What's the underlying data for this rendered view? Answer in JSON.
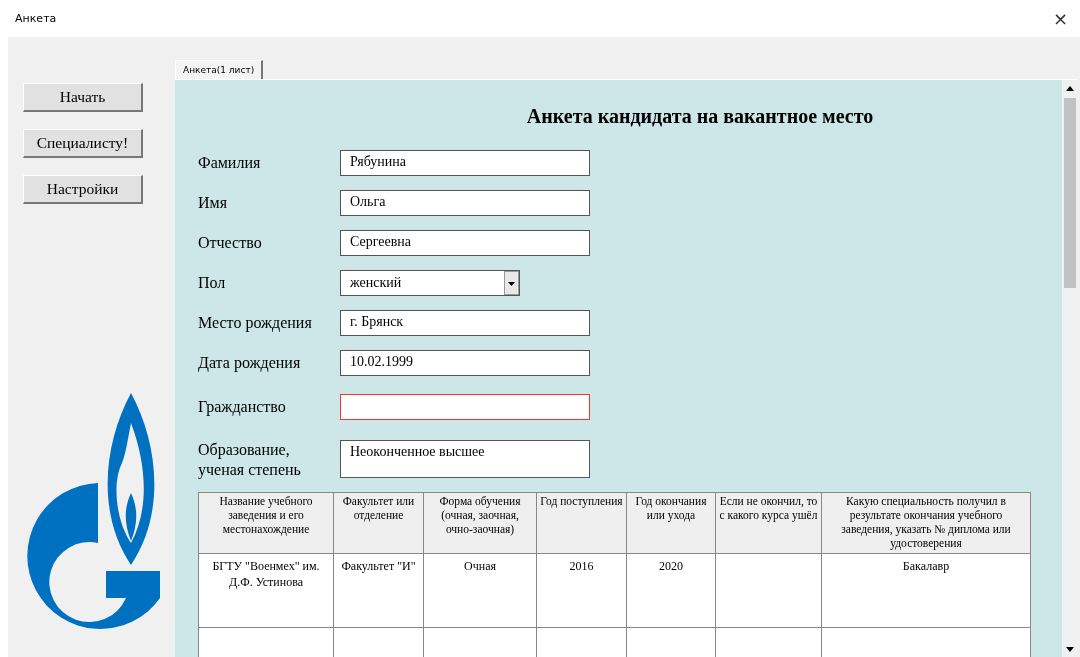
{
  "window": {
    "title": "Анкета",
    "close": "×"
  },
  "sidebar": {
    "buttons": [
      "Начать",
      "Специалисту!",
      "Настройки"
    ]
  },
  "tabs": [
    {
      "label": "Анкета(1 лист)",
      "selected": true
    }
  ],
  "form": {
    "title": "Анкета кандидата на вакантное место",
    "fields": [
      {
        "label": "Фамилия",
        "kind": "text",
        "value": "Рябунина"
      },
      {
        "label": "Имя",
        "kind": "text",
        "value": "Ольга"
      },
      {
        "label": "Отчество",
        "kind": "text",
        "value": "Сергеевна"
      },
      {
        "label": "Пол",
        "kind": "combo",
        "value": "женский"
      },
      {
        "label": "Место рождения",
        "kind": "text",
        "value": "г. Брянск"
      },
      {
        "label": "Дата рождения",
        "kind": "text",
        "value": "10.02.1999"
      },
      {
        "label": "Гражданство",
        "kind": "text",
        "error": true
      },
      {
        "label": "Образование, ученая степень",
        "kind": "multiline",
        "value": "Неоконченное высшее"
      }
    ]
  },
  "education_table": {
    "columns": [
      "Название учебного заведения и его местонахождение",
      "Факультет или отделение",
      "Форма обучения (очная, заочная, очно-заочная)",
      "Год поступления",
      "Год окончания или ухода",
      "Если не окончил, то с какого курса ушёл",
      "Какую специальность получил в результате окончания учебного заведения, указать № диплома или удостоверения"
    ],
    "rows": [
      [
        "БГТУ \"Военмех\" им. Д.Ф. Устинова",
        "Факультет \"И\"",
        "Очная",
        "2016",
        "2020",
        null,
        "Бакалавр"
      ]
    ]
  }
}
